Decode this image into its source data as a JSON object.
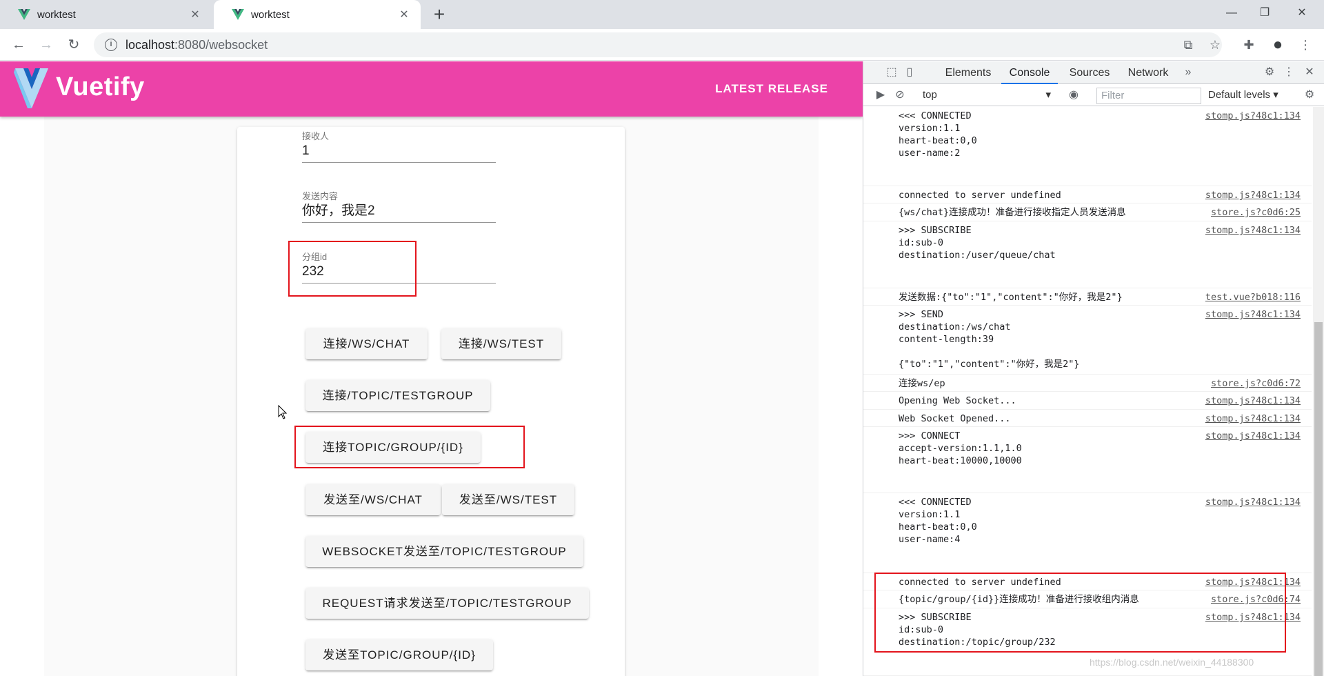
{
  "browser": {
    "tabs": [
      {
        "title": "worktest",
        "active": false
      },
      {
        "title": "worktest",
        "active": true
      }
    ],
    "url_host": "localhost",
    "url_rest": ":8080/websocket",
    "favicon_icon": "vue-logo-icon"
  },
  "app": {
    "brand": "Vuetify",
    "release_label": "LATEST RELEASE",
    "appbar_color": "#ec42a8"
  },
  "form": {
    "fields": [
      {
        "label": "接收人",
        "value": "1"
      },
      {
        "label": "发送内容",
        "value": "你好，我是2"
      },
      {
        "label": "分组id",
        "value": "232"
      }
    ],
    "buttons": [
      "连接/WS/CHAT",
      "连接/WS/TEST",
      "连接/TOPIC/TESTGROUP",
      "连接TOPIC/GROUP/{ID}",
      "发送至/WS/CHAT",
      "发送至/WS/TEST",
      "WEBSOCKET发送至/TOPIC/TESTGROUP",
      "REQUEST请求发送至/TOPIC/TESTGROUP",
      "发送至TOPIC/GROUP/{ID}"
    ]
  },
  "devtools": {
    "tabs": [
      "Elements",
      "Console",
      "Sources",
      "Network"
    ],
    "active_tab": "Console",
    "context": "top",
    "filter_placeholder": "Filter",
    "levels": "Default levels",
    "messages": [
      {
        "text": "<<< CONNECTED\nversion:1.1\nheart-beat:0,0\nuser-name:2",
        "source": "stomp.js?48c1:134"
      },
      {
        "text": "connected to server undefined",
        "source": "stomp.js?48c1:134"
      },
      {
        "text": "{ws/chat}连接成功！准备进行接收指定人员发送消息",
        "source": "store.js?c0d6:25"
      },
      {
        "text": ">>> SUBSCRIBE\nid:sub-0\ndestination:/user/queue/chat",
        "source": "stomp.js?48c1:134"
      },
      {
        "text": "发送数据:{\"to\":\"1\",\"content\":\"你好，我是2\"}",
        "source": "test.vue?b018:116"
      },
      {
        "text": ">>> SEND\ndestination:/ws/chat\ncontent-length:39\n\n{\"to\":\"1\",\"content\":\"你好，我是2\"}",
        "source": "stomp.js?48c1:134"
      },
      {
        "text": "连接ws/ep",
        "source": "store.js?c0d6:72"
      },
      {
        "text": "Opening Web Socket...",
        "source": "stomp.js?48c1:134"
      },
      {
        "text": "Web Socket Opened...",
        "source": "stomp.js?48c1:134"
      },
      {
        "text": ">>> CONNECT\naccept-version:1.1,1.0\nheart-beat:10000,10000",
        "source": "stomp.js?48c1:134"
      },
      {
        "text": "<<< CONNECTED\nversion:1.1\nheart-beat:0,0\nuser-name:4",
        "source": "stomp.js?48c1:134"
      },
      {
        "text": "connected to server undefined",
        "source": "stomp.js?48c1:134"
      },
      {
        "text": "{topic/group/{id}}连接成功！准备进行接收组内消息",
        "source": "store.js?c0d6:74"
      },
      {
        "text": ">>> SUBSCRIBE\nid:sub-0\ndestination:/topic/group/232",
        "source": "stomp.js?48c1:134"
      }
    ]
  },
  "watermark": "https://blog.csdn.net/weixin_44188300",
  "highlight_color": "#e3141c"
}
